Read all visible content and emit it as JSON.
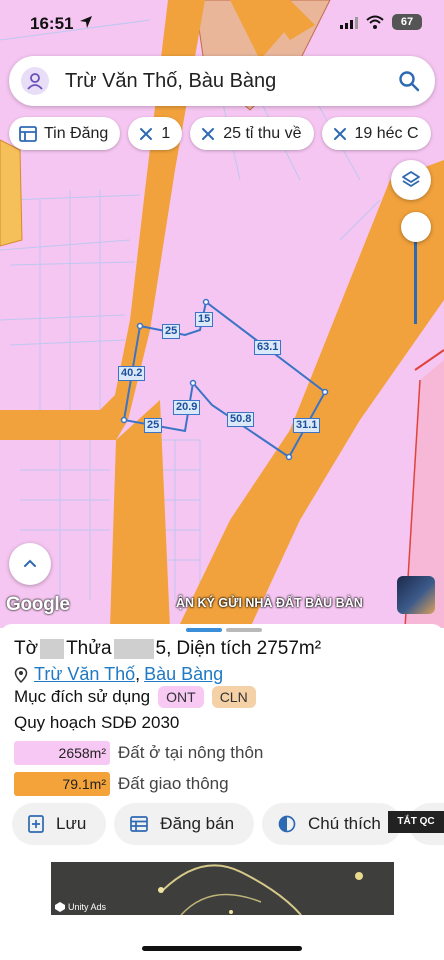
{
  "status_bar": {
    "time": "16:51",
    "battery": "67"
  },
  "search": {
    "query": "Trừ Văn Thố, Bàu Bàng"
  },
  "chips": [
    {
      "label": "Tin Đăng",
      "icon": "table-icon"
    },
    {
      "label": "1",
      "icon": "sparkle-icon"
    },
    {
      "label": "25 tỉ thu về",
      "icon": "sparkle-icon"
    },
    {
      "label": "19 héc C",
      "icon": "sparkle-icon"
    }
  ],
  "map": {
    "google_label": "Google",
    "banner_text": "ẬN KÝ GỬI NHÀ ĐẤT BÀU BÀN",
    "segments": [
      "25",
      "15",
      "63.1",
      "40.2",
      "20.9",
      "50.8",
      "31.1",
      "25"
    ]
  },
  "parcel": {
    "to_label": "Tờ",
    "thua_label": "Thửa",
    "thua_suffix": "5,",
    "area_label": "Diện tích 2757m²",
    "street": "Trừ Văn Thố",
    "district": "Bàu Bàng",
    "purpose_label": "Mục đích sử dụng",
    "tags": [
      "ONT",
      "CLN"
    ],
    "plan_label": "Quy hoạch SDĐ 2030",
    "legend": [
      {
        "value": "2658m²",
        "label": "Đất ở tại nông thôn",
        "color": "#f8c8f4"
      },
      {
        "value": "79.1m²",
        "label": "Đất giao thông",
        "color": "#f4a23a"
      }
    ]
  },
  "actions": {
    "save": "Lưu",
    "post": "Đăng bán",
    "legend": "Chú thích"
  },
  "ad": {
    "tatqc": "TẮT QC",
    "unity": "Unity Ads"
  },
  "colors": {
    "road": "#f2a23c",
    "land": "#f6c6f2",
    "accent": "#3b74c6"
  }
}
